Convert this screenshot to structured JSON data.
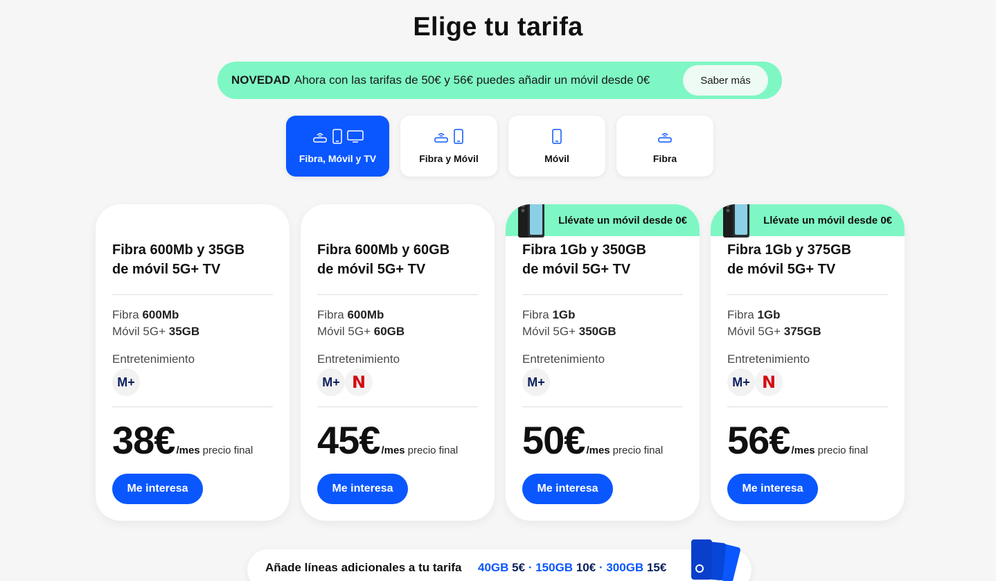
{
  "page_title": "Elige tu tarifa",
  "promo": {
    "strong": "NOVEDAD",
    "text": "Ahora con las tarifas de 50€ y 56€ puedes añadir un móvil desde 0€",
    "button": "Saber más"
  },
  "tabs": [
    {
      "label": "Fibra, Móvil y TV",
      "icons": [
        "router-icon",
        "phone-icon",
        "tv-icon"
      ],
      "active": true
    },
    {
      "label": "Fibra y Móvil",
      "icons": [
        "router-icon",
        "phone-icon"
      ],
      "active": false
    },
    {
      "label": "Móvil",
      "icons": [
        "phone-icon"
      ],
      "active": false
    },
    {
      "label": "Fibra",
      "icons": [
        "router-icon"
      ],
      "active": false
    }
  ],
  "cards": [
    {
      "badge": "",
      "title_line1": "Fibra 600Mb y 35GB",
      "title_line2": "de móvil 5G+ TV",
      "fibra_label": "Fibra",
      "fibra_value": "600Mb",
      "movil_label": "Móvil 5G+",
      "movil_value": "35GB",
      "entertainment_label": "Entretenimiento",
      "entertainment": [
        "M+"
      ],
      "price": "38€",
      "per": "/mes",
      "note": "precio final",
      "cta": "Me interesa"
    },
    {
      "badge": "",
      "title_line1": "Fibra 600Mb y 60GB",
      "title_line2": "de móvil 5G+ TV",
      "fibra_label": "Fibra",
      "fibra_value": "600Mb",
      "movil_label": "Móvil 5G+",
      "movil_value": "60GB",
      "entertainment_label": "Entretenimiento",
      "entertainment": [
        "M+",
        "N"
      ],
      "price": "45€",
      "per": "/mes",
      "note": "precio final",
      "cta": "Me interesa"
    },
    {
      "badge": "Llévate un móvil desde 0€",
      "title_line1": "Fibra 1Gb y 350GB",
      "title_line2": "de móvil 5G+ TV",
      "fibra_label": "Fibra",
      "fibra_value": "1Gb",
      "movil_label": "Móvil 5G+",
      "movil_value": "350GB",
      "entertainment_label": "Entretenimiento",
      "entertainment": [
        "M+"
      ],
      "price": "50€",
      "per": "/mes",
      "note": "precio final",
      "cta": "Me interesa"
    },
    {
      "badge": "Llévate un móvil desde 0€",
      "title_line1": "Fibra 1Gb y 375GB",
      "title_line2": "de móvil 5G+ TV",
      "fibra_label": "Fibra",
      "fibra_value": "1Gb",
      "movil_label": "Móvil 5G+",
      "movil_value": "375GB",
      "entertainment_label": "Entretenimiento",
      "entertainment": [
        "M+",
        "N"
      ],
      "price": "56€",
      "per": "/mes",
      "note": "precio final",
      "cta": "Me interesa"
    }
  ],
  "extra_lines": {
    "label": "Añade líneas adicionales a tu tarifa",
    "offers": [
      {
        "gb": "40GB",
        "price": "5€"
      },
      {
        "gb": "150GB",
        "price": "10€"
      },
      {
        "gb": "300GB",
        "price": "15€"
      }
    ],
    "separator": "·"
  },
  "colors": {
    "brand_blue": "#0a57ff",
    "mint": "#7ef7c4",
    "netflix_red": "#d40d12",
    "movistar_navy": "#0b1f5c"
  }
}
